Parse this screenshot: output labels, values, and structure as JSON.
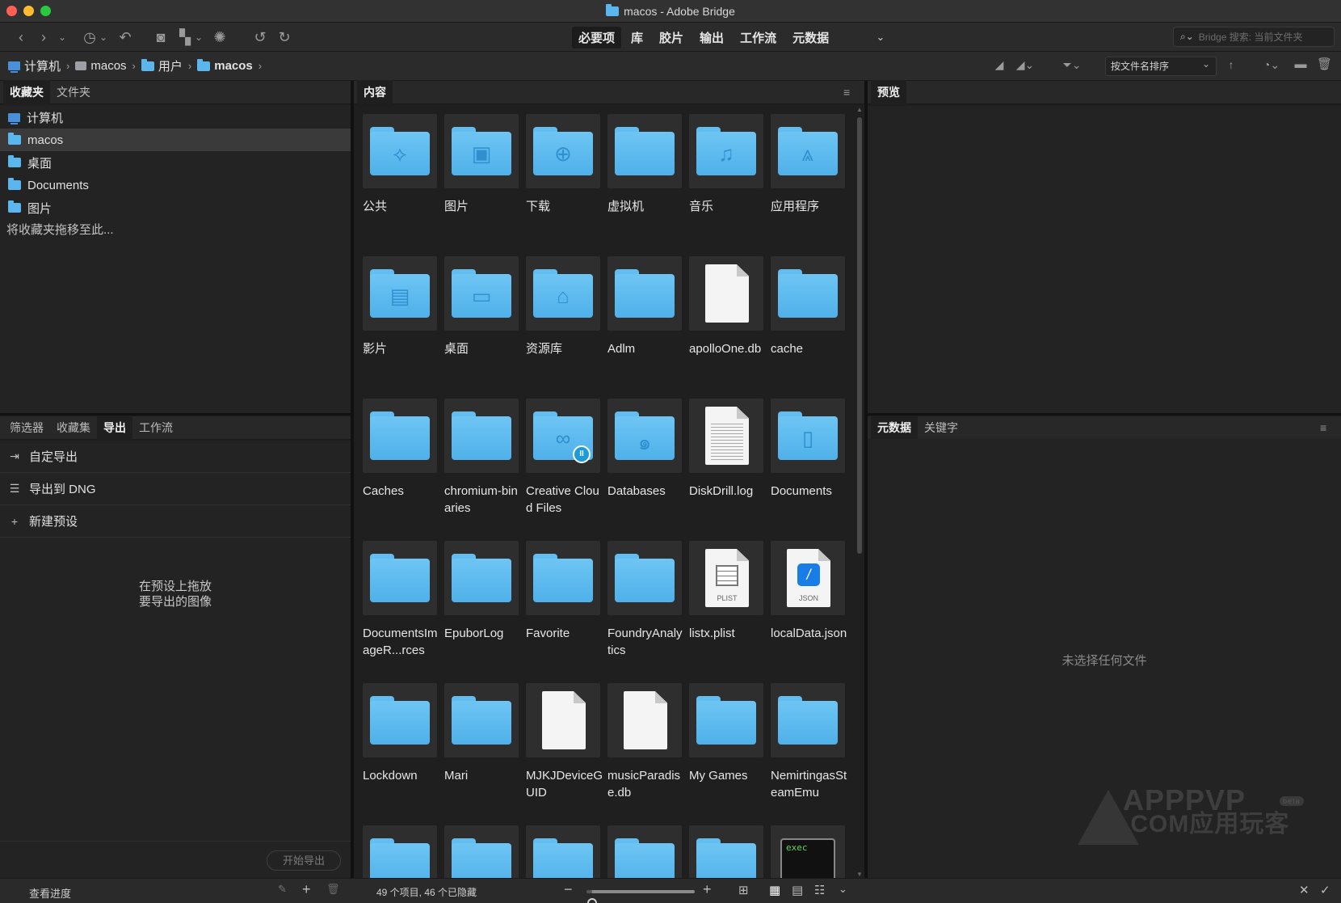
{
  "window": {
    "title": "macos - Adobe Bridge"
  },
  "toolbar": {
    "workspaces": [
      "必要项",
      "库",
      "胶片",
      "输出",
      "工作流",
      "元数据"
    ],
    "search_placeholder": "Bridge 搜索: 当前文件夹"
  },
  "path": {
    "crumbs": [
      "计算机",
      "macos",
      "用户",
      "macos"
    ],
    "sort_label": "按文件名排序"
  },
  "favorites_panel": {
    "tabs": [
      "收藏夹",
      "文件夹"
    ],
    "items": [
      "计算机",
      "macos",
      "桌面",
      "Documents",
      "图片"
    ],
    "hint": "将收藏夹拖移至此..."
  },
  "export_panel": {
    "tabs": [
      "筛选器",
      "收藏集",
      "导出",
      "工作流"
    ],
    "items": [
      "自定导出",
      "导出到 DNG",
      "新建预设"
    ],
    "drop_hint_line1": "在预设上拖放",
    "drop_hint_line2": "要导出的图像",
    "start_export": "开始导出",
    "view_progress": "查看进度"
  },
  "content_panel": {
    "tab": "内容",
    "status": "49 个项目, 46 个已隐藏",
    "zoom_fraction": 0.05,
    "rows": [
      [
        {
          "label": "公共",
          "type": "folder",
          "icon": "public-icon",
          "glyph": "⟡"
        },
        {
          "label": "图片",
          "type": "folder",
          "icon": "picture-icon",
          "glyph": "▣"
        },
        {
          "label": "下载",
          "type": "folder",
          "icon": "download-icon",
          "glyph": "⊕"
        },
        {
          "label": "虚拟机",
          "type": "folder",
          "icon": "folder-icon",
          "glyph": ""
        },
        {
          "label": "音乐",
          "type": "folder",
          "icon": "music-icon",
          "glyph": "♫"
        },
        {
          "label": "应用程序",
          "type": "folder",
          "icon": "apps-icon",
          "glyph": "⩓"
        }
      ],
      [
        {
          "label": "影片",
          "type": "folder",
          "icon": "movie-icon",
          "glyph": "▤"
        },
        {
          "label": "桌面",
          "type": "folder",
          "icon": "desktop-icon",
          "glyph": "▭"
        },
        {
          "label": "资源库",
          "type": "folder",
          "icon": "library-icon",
          "glyph": "⌂"
        },
        {
          "label": "Adlm",
          "type": "folder",
          "icon": "folder-icon",
          "glyph": ""
        },
        {
          "label": "apolloOne.db",
          "type": "doc",
          "icon": "document-icon"
        },
        {
          "label": "cache",
          "type": "folder",
          "icon": "folder-icon",
          "glyph": ""
        }
      ],
      [
        {
          "label": "Caches",
          "type": "folder",
          "icon": "folder-icon",
          "glyph": ""
        },
        {
          "label": "chromium-binaries",
          "type": "folder",
          "icon": "folder-icon",
          "glyph": ""
        },
        {
          "label": "Creative Cloud Files",
          "type": "folder",
          "icon": "creative-cloud-icon",
          "glyph": "∞",
          "badge": "II"
        },
        {
          "label": "Databases",
          "type": "folder",
          "icon": "databases-icon",
          "glyph": "๑"
        },
        {
          "label": "DiskDrill.log",
          "type": "doclines",
          "icon": "log-document-icon"
        },
        {
          "label": "Documents",
          "type": "folder",
          "icon": "documents-icon",
          "glyph": "▯"
        }
      ],
      [
        {
          "label": "DocumentsImageR...rces",
          "type": "folder",
          "icon": "folder-icon",
          "glyph": ""
        },
        {
          "label": "EpuborLog",
          "type": "folder",
          "icon": "folder-icon",
          "glyph": ""
        },
        {
          "label": "Favorite",
          "type": "folder",
          "icon": "folder-icon",
          "glyph": ""
        },
        {
          "label": "FoundryAnalytics",
          "type": "folder",
          "icon": "folder-icon",
          "glyph": ""
        },
        {
          "label": "listx.plist",
          "type": "plist",
          "icon": "plist-icon",
          "tag": "PLIST"
        },
        {
          "label": "localData.json",
          "type": "json",
          "icon": "json-icon",
          "tag": "JSON"
        }
      ],
      [
        {
          "label": "Lockdown",
          "type": "folder",
          "icon": "folder-icon",
          "glyph": ""
        },
        {
          "label": "Mari",
          "type": "folder",
          "icon": "folder-icon",
          "glyph": ""
        },
        {
          "label": "MJKJDeviceGUID",
          "type": "doc",
          "icon": "document-icon"
        },
        {
          "label": "musicParadise.db",
          "type": "doc",
          "icon": "document-icon"
        },
        {
          "label": "My Games",
          "type": "folder",
          "icon": "folder-icon",
          "glyph": ""
        },
        {
          "label": "NemirtingasSteamEmu",
          "type": "folder",
          "icon": "folder-icon",
          "glyph": ""
        }
      ],
      [
        {
          "label": "",
          "type": "folder",
          "icon": "folder-icon",
          "glyph": ""
        },
        {
          "label": "",
          "type": "folder",
          "icon": "folder-icon",
          "glyph": ""
        },
        {
          "label": "",
          "type": "folder",
          "icon": "folder-icon",
          "glyph": ""
        },
        {
          "label": "",
          "type": "folder",
          "icon": "folder-icon",
          "glyph": ""
        },
        {
          "label": "",
          "type": "folder",
          "icon": "folder-icon",
          "glyph": ""
        },
        {
          "label": "",
          "type": "exec",
          "icon": "exec-icon",
          "tag": "exec"
        }
      ]
    ]
  },
  "preview_panel": {
    "tab": "预览"
  },
  "metadata_panel": {
    "tabs": [
      "元数据",
      "关键字"
    ],
    "empty": "未选择任何文件"
  },
  "watermark": {
    "line1": "APPPVP",
    "line2": ".COM应用玩客",
    "beta": "beta"
  },
  "colors": {
    "folder": "#5ab6ec",
    "background": "#1e1e1e",
    "panel": "#232323"
  }
}
